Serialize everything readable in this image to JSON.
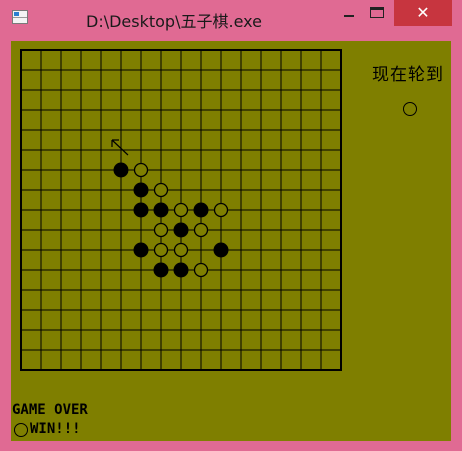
{
  "window": {
    "title": "D:\\Desktop\\五子棋.exe",
    "close_glyph": "✕",
    "frame_color": "#e06a93",
    "close_color": "#c7353f"
  },
  "game": {
    "board_color": "#7f7f00",
    "grid_lines": 17,
    "turn_label": "现在轮到",
    "current_turn": "white",
    "status_text": "GAME OVER",
    "winner": "white",
    "win_text": "WIN!!!",
    "stones": [
      {
        "col": 5,
        "row": 6,
        "color": "black"
      },
      {
        "col": 6,
        "row": 6,
        "color": "white"
      },
      {
        "col": 6,
        "row": 7,
        "color": "black"
      },
      {
        "col": 7,
        "row": 7,
        "color": "white"
      },
      {
        "col": 6,
        "row": 8,
        "color": "black"
      },
      {
        "col": 7,
        "row": 8,
        "color": "black"
      },
      {
        "col": 8,
        "row": 8,
        "color": "white"
      },
      {
        "col": 9,
        "row": 8,
        "color": "black"
      },
      {
        "col": 10,
        "row": 8,
        "color": "white"
      },
      {
        "col": 7,
        "row": 9,
        "color": "white"
      },
      {
        "col": 8,
        "row": 9,
        "color": "black"
      },
      {
        "col": 9,
        "row": 9,
        "color": "white"
      },
      {
        "col": 6,
        "row": 10,
        "color": "black"
      },
      {
        "col": 7,
        "row": 10,
        "color": "white"
      },
      {
        "col": 8,
        "row": 10,
        "color": "white"
      },
      {
        "col": 10,
        "row": 10,
        "color": "black"
      },
      {
        "col": 7,
        "row": 11,
        "color": "black"
      },
      {
        "col": 8,
        "row": 11,
        "color": "black"
      },
      {
        "col": 9,
        "row": 11,
        "color": "white"
      }
    ]
  }
}
